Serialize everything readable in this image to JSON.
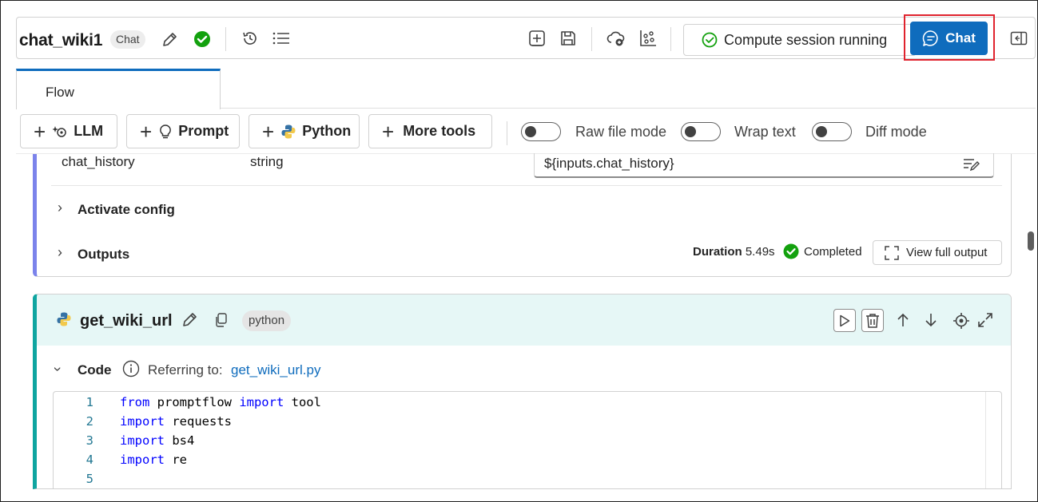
{
  "header": {
    "flow_name": "chat_wiki1",
    "flow_type_chip": "Chat",
    "compute_status": "Compute session running",
    "chat_button": "Chat"
  },
  "tabs": [
    {
      "label": "Flow",
      "active": true
    }
  ],
  "toolbar": {
    "buttons": [
      "LLM",
      "Prompt",
      "Python",
      "More tools"
    ],
    "toggles": [
      {
        "label": "Raw file mode",
        "on": false
      },
      {
        "label": "Wrap text",
        "on": false
      },
      {
        "label": "Diff mode",
        "on": false
      }
    ]
  },
  "llm_node": {
    "input_row": {
      "name": "chat_history",
      "type": "string",
      "value": "${inputs.chat_history}"
    },
    "activate_config_label": "Activate config",
    "outputs_label": "Outputs",
    "duration_label": "Duration",
    "duration_value": "5.49s",
    "status": "Completed",
    "view_full_output": "View full output"
  },
  "python_node": {
    "name": "get_wiki_url",
    "chip": "python",
    "code_label": "Code",
    "referring_label": "Referring to:",
    "file_link": "get_wiki_url.py",
    "code_lines": [
      {
        "n": "1",
        "kw1": "from",
        "t1": " promptflow ",
        "kw2": "import",
        "t2": " tool"
      },
      {
        "n": "2",
        "kw1": "import",
        "t1": " requests",
        "kw2": "",
        "t2": ""
      },
      {
        "n": "3",
        "kw1": "import",
        "t1": " bs4",
        "kw2": "",
        "t2": ""
      },
      {
        "n": "4",
        "kw1": "import",
        "t1": " re",
        "kw2": "",
        "t2": ""
      },
      {
        "n": "5",
        "kw1": "",
        "t1": "",
        "kw2": "",
        "t2": ""
      }
    ]
  },
  "colors": {
    "accent": "#0f6cbd",
    "success": "#13a10e",
    "llm_bar": "#7b83eb",
    "python_bar": "#0ea5a0",
    "highlight": "#e0232e"
  }
}
